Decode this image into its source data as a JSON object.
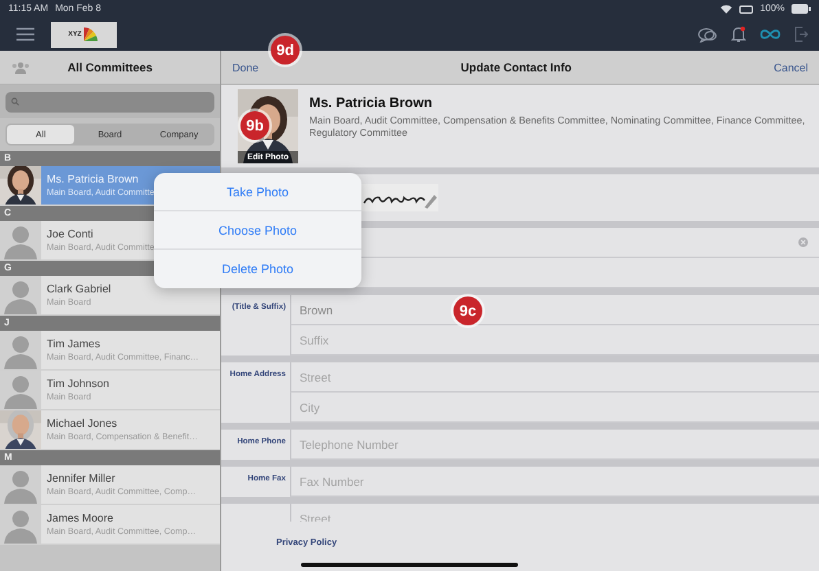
{
  "status_bar": {
    "time": "11:15 AM",
    "date": "Mon Feb 8",
    "battery": "100%"
  },
  "app_bar": {
    "logo_text": "XYZ",
    "notification_dot": true
  },
  "sidebar": {
    "title": "All Committees",
    "segments": [
      {
        "label": "All",
        "selected": true
      },
      {
        "label": "Board",
        "selected": false
      },
      {
        "label": "Company",
        "selected": false
      }
    ],
    "contacts": [
      {
        "kind": "header",
        "label": "B"
      },
      {
        "kind": "contact",
        "name": "Ms. Patricia Brown",
        "committees": "Main Board, Audit Committe",
        "has_photo": true,
        "selected": true
      },
      {
        "kind": "header",
        "label": "C"
      },
      {
        "kind": "contact",
        "name": "Joe Conti",
        "committees": "Main Board, Audit Committe",
        "has_photo": false,
        "selected": false
      },
      {
        "kind": "header",
        "label": "G"
      },
      {
        "kind": "contact",
        "name": "Clark Gabriel",
        "committees": "Main Board",
        "has_photo": false,
        "selected": false
      },
      {
        "kind": "header",
        "label": "J"
      },
      {
        "kind": "contact",
        "name": "Tim James",
        "committees": "Main Board, Audit Committee, Financ…",
        "has_photo": false,
        "selected": false
      },
      {
        "kind": "contact",
        "name": "Tim Johnson",
        "committees": "Main Board",
        "has_photo": false,
        "selected": false
      },
      {
        "kind": "contact",
        "name": "Michael Jones",
        "committees": "Main Board, Compensation & Benefit…",
        "has_photo": true,
        "selected": false
      },
      {
        "kind": "header",
        "label": "M"
      },
      {
        "kind": "contact",
        "name": "Jennifer Miller",
        "committees": "Main Board, Audit Committee, Comp…",
        "has_photo": false,
        "selected": false
      },
      {
        "kind": "contact",
        "name": "James Moore",
        "committees": "Main Board, Audit Committee, Comp…",
        "has_photo": false,
        "selected": false
      }
    ]
  },
  "detail": {
    "done": "Done",
    "title": "Update Contact Info",
    "cancel": "Cancel",
    "name": "Ms. Patricia Brown",
    "committees": "Main Board, Audit Committee, Compensation & Benefits Committee, Nominating Committee, Finance Committee, Regulatory Committee",
    "edit_photo": "Edit Photo",
    "groups": [
      {
        "fields": [
          {
            "kind": "clearable"
          },
          {
            "kind": "plain"
          }
        ]
      },
      {
        "label": "(Title & Suffix)",
        "fields": [
          {
            "kind": "plain",
            "value": "Brown"
          },
          {
            "kind": "plain",
            "placeholder": "Suffix"
          }
        ]
      },
      {
        "label": "Home Address",
        "fields": [
          {
            "kind": "plain",
            "placeholder": "Street"
          },
          {
            "kind": "plain",
            "placeholder": "City"
          }
        ]
      },
      {
        "label": "Home Phone",
        "fields": [
          {
            "kind": "plain",
            "placeholder": "Telephone Number"
          }
        ]
      },
      {
        "label": "Home Fax",
        "fields": [
          {
            "kind": "plain",
            "placeholder": "Fax Number"
          }
        ]
      },
      {
        "fields": [
          {
            "kind": "plain",
            "placeholder": "Street"
          }
        ]
      }
    ],
    "footer_link": "Privacy Policy"
  },
  "popover": [
    "Take Photo",
    "Choose Photo",
    "Delete Photo"
  ],
  "callouts": [
    "9d",
    "9b",
    "9c"
  ]
}
